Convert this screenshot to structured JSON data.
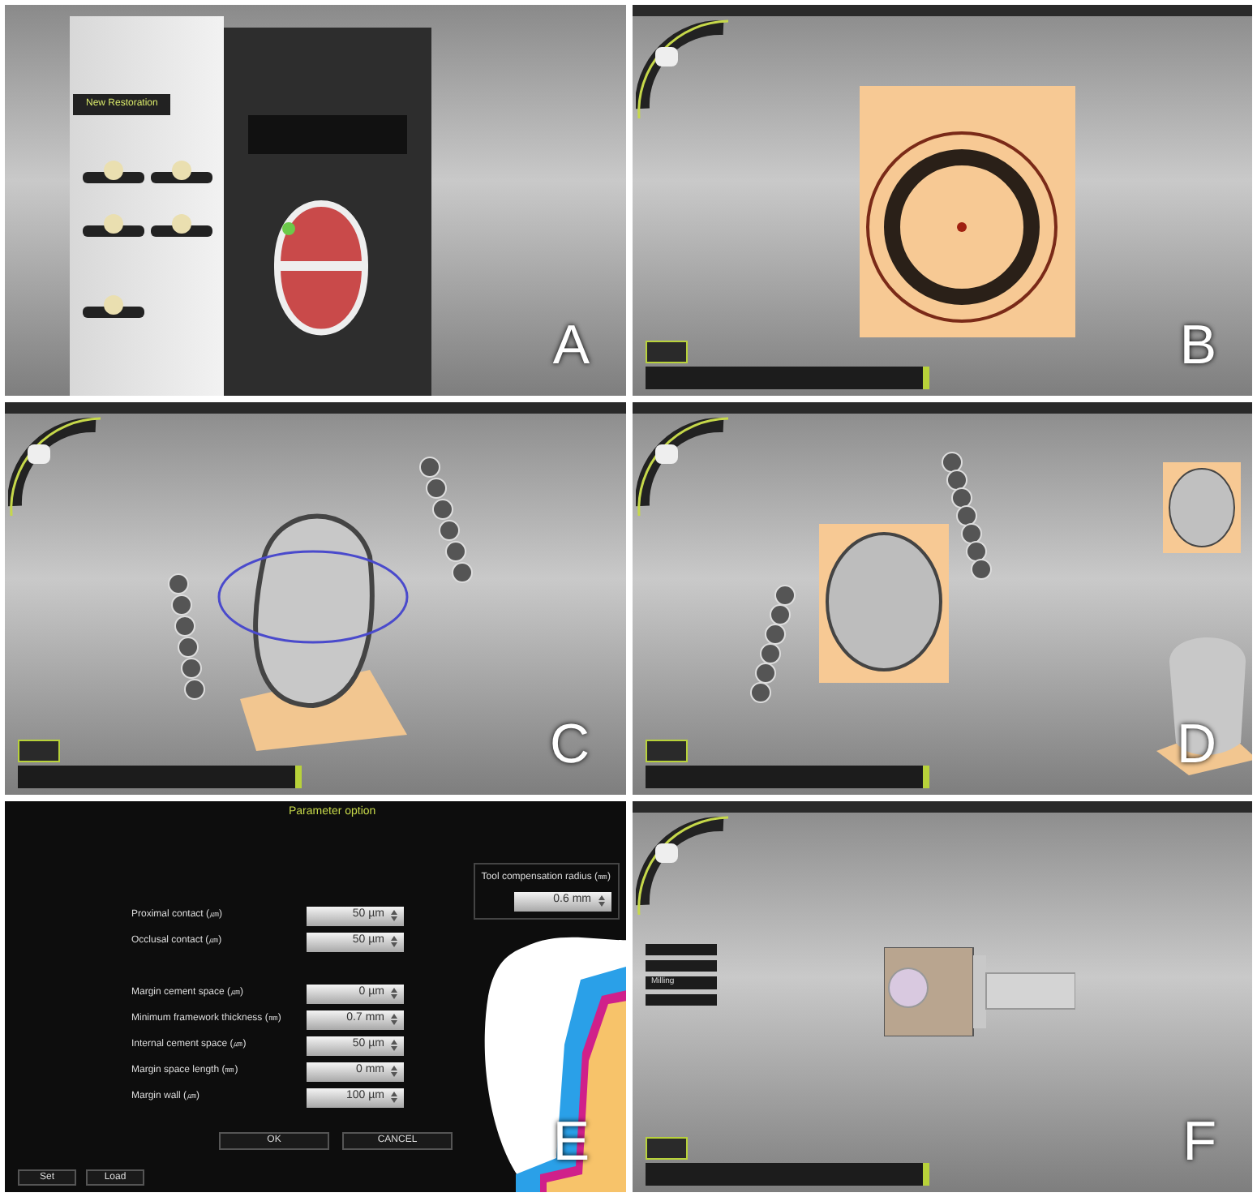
{
  "panels": [
    {
      "kind": "restoration",
      "letter": "A",
      "menu_title": "New Restoration"
    },
    {
      "kind": "margin",
      "letter": "B"
    },
    {
      "kind": "crown_axis",
      "letter": "C"
    },
    {
      "kind": "crown_views",
      "letter": "D"
    },
    {
      "kind": "parameters",
      "letter": "E",
      "dialog_title": "Parameter option",
      "tool_label": "Tool compensation radius (㎜)",
      "tool_value": "0.6 mm",
      "params": [
        {
          "label": "Proximal contact (㎛)",
          "value": "50 µm"
        },
        {
          "label": "Occlusal contact (㎛)",
          "value": "50 µm"
        },
        {
          "label": "Margin cement space (㎛)",
          "value": "0 µm"
        },
        {
          "label": "Minimum framework thickness (㎜)",
          "value": "0.7 mm"
        },
        {
          "label": "Internal cement space (㎛)",
          "value": "50 µm"
        },
        {
          "label": "Margin space length (㎜)",
          "value": "0 mm"
        },
        {
          "label": "Margin wall (㎛)",
          "value": "100 µm"
        }
      ],
      "buttons": [
        "OK",
        "CANCEL"
      ],
      "footer_buttons": [
        "Set",
        "Load"
      ]
    },
    {
      "kind": "milling",
      "letter": "F",
      "menu_items": [
        "Milling"
      ]
    }
  ]
}
